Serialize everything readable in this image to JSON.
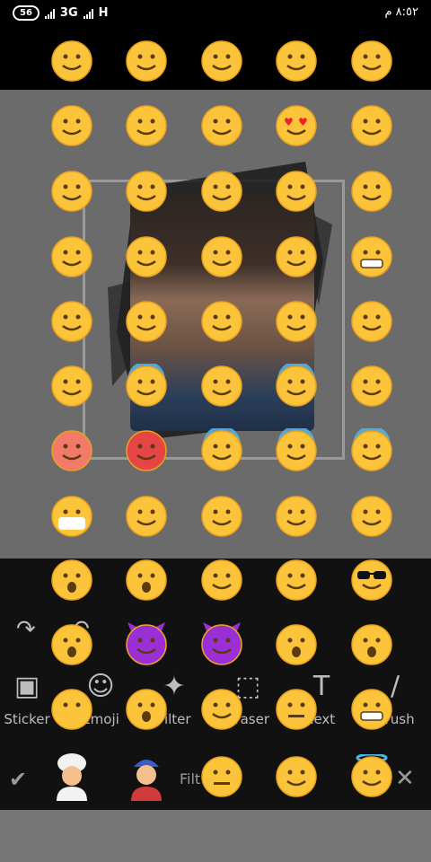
{
  "status_bar": {
    "battery": "56",
    "network": "3G",
    "network2": "H",
    "clock": "٨:٥٢ م"
  },
  "colors": {
    "emoji_yellow": "#fbc43a",
    "emoji_outline": "#e9a21d",
    "canvas_bg": "#6b6b6b",
    "toolbar_bg": "#111111",
    "nav_bar": "#757575",
    "devil_purple": "#9b2fd6"
  },
  "tools": [
    {
      "icon": "sticker-icon",
      "label": "Sticker"
    },
    {
      "icon": "emoji-icon",
      "label": "Emoji"
    },
    {
      "icon": "filter-icon",
      "label": "Filter"
    },
    {
      "icon": "eraser-icon",
      "label": "Eraser"
    },
    {
      "icon": "text-icon",
      "label": "Text"
    },
    {
      "icon": "brush-icon",
      "label": "Brush"
    }
  ],
  "bottom": {
    "filter_caption": "Filt"
  },
  "emoji_grid_icons": [
    "smiling-blush-icon",
    "grin-icon",
    "beaming-icon",
    "smiley-icon",
    "grin-squint-icon",
    "kissing-icon",
    "kissing-blush-icon",
    "kiss-heart-icon",
    "heart-eyes-icon",
    "wink-icon",
    "flushed-icon",
    "tongue-icon",
    "tongue-squint-icon",
    "tongue-wink-icon",
    "kissing-smile-icon",
    "frown-icon",
    "unamused-icon",
    "relieved-icon",
    "pensive-icon",
    "grimace-icon",
    "sleepy-icon",
    "loud-cry-icon",
    "tears-joy-icon",
    "sad-tear-icon",
    "confounded-icon",
    "weary-icon",
    "downcast-sweat-icon",
    "grin-sweat-icon",
    "anxious-sweat-icon",
    "worried-icon",
    "angry-icon",
    "pouting-icon",
    "scream-icon",
    "fearful-icon",
    "tired-icon",
    "mask-icon",
    "yum-icon",
    "laughing-icon",
    "confounded-wavy-icon",
    "triumph-icon",
    "sad-frown-icon",
    "astonished-icon",
    "dizzy-icon",
    "sleeping-icon",
    "sunglasses-icon",
    "hushed-icon",
    "devil-smile-icon",
    "devil-angry-icon",
    "anguish-icon",
    "open-mouth-icon",
    "no-mouth-icon",
    "astonished-brow-icon",
    "confused-icon",
    "neutral-icon",
    "grimacing-icon",
    "expressionless-icon",
    "smirk-icon",
    "halo-icon"
  ],
  "people_icons": [
    "turban-person-icon",
    "boy-cap-icon"
  ]
}
